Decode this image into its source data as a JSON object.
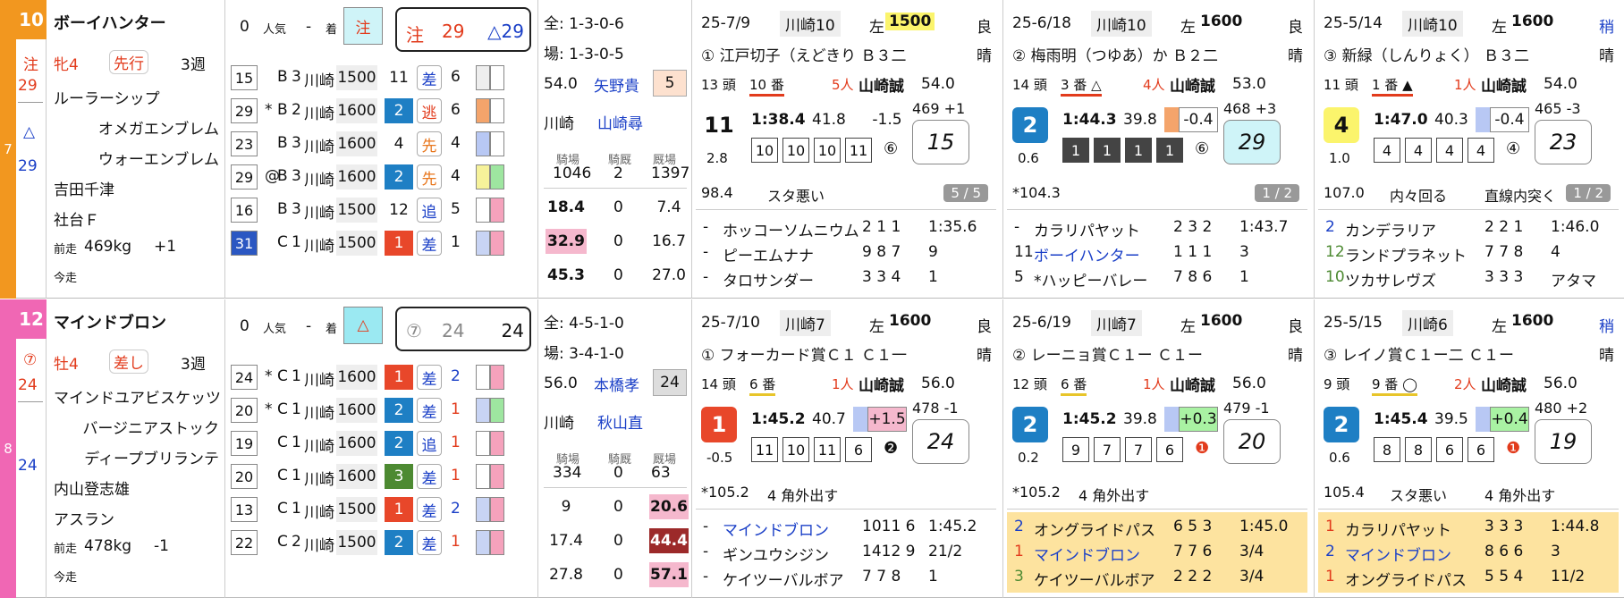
{
  "horses": [
    {
      "gate": "7",
      "num": "10",
      "gate_color": "#f2971f",
      "num_color": "#f2971f",
      "mark": "注",
      "mark_val": "29",
      "sub_mark": "△",
      "sub_val": "29",
      "name": "ボーイハンター",
      "sex_age": "牝4",
      "style": "先行",
      "weeks": "3週",
      "sire": "ルーラーシップ",
      "dam": "オメガエンブレム",
      "damsire": "ウォーエンブレム",
      "trainer": "吉田千津",
      "owner": "社台Ｆ",
      "prev_label": "前走",
      "prev_weight": "469kg",
      "prev_diff": "+1",
      "today_label": "今走",
      "pop": "0",
      "pop_label": "人気",
      "dash": "-",
      "chaku": "着",
      "pred_mark": "注",
      "pred_mark_bg": "#cff4f8",
      "pred_box": [
        "注",
        "29",
        "△29"
      ],
      "past": [
        {
          "a": "15",
          "b": "",
          "cls": "B",
          "g": "3",
          "track": "川崎",
          "dist": "1500",
          "p": "11",
          "pc": "",
          "run": "差",
          "r": "6",
          "c1": "#eee",
          "c2": "#fff"
        },
        {
          "a": "29",
          "b": "*",
          "cls": "B",
          "g": "2",
          "track": "川崎",
          "dist": "1600",
          "p": "2",
          "pc": "#1e7fc4",
          "run": "逃",
          "r": "6",
          "c1": "#f4a46b",
          "c2": "#fff"
        },
        {
          "a": "23",
          "b": "",
          "cls": "B",
          "g": "3",
          "track": "川崎",
          "dist": "1600",
          "p": "4",
          "pc": "",
          "run": "先",
          "r": "4",
          "c1": "#b8c8f4",
          "c2": "#fff"
        },
        {
          "a": "29",
          "b": "@",
          "cls": "B",
          "g": "3",
          "track": "川崎",
          "dist": "1600",
          "p": "2",
          "pc": "#1e7fc4",
          "run": "先",
          "r": "4",
          "c1": "#f6f29a",
          "c2": "#9ee6a0"
        },
        {
          "a": "16",
          "b": "",
          "cls": "B",
          "g": "3",
          "track": "川崎",
          "dist": "1500",
          "p": "12",
          "pc": "",
          "run": "追",
          "r": "5",
          "c1": "#fff",
          "c2": "#f5a2bc"
        },
        {
          "a": "31",
          "b": "",
          "cls": "C",
          "g": "1",
          "track": "川崎",
          "dist": "1500",
          "p": "1",
          "pc": "#e8472a",
          "run": "差",
          "r": "1",
          "c1": "#c8d4f4",
          "c2": "#f5a2bc"
        }
      ],
      "stats": {
        "all": "全: 1-3-0-6",
        "place": "場: 1-3-0-5",
        "weight": "54.0",
        "jockey": "矢野貴",
        "jnum": "5",
        "track": "川崎",
        "trainer2": "山崎尋",
        "h1": "騎場",
        "h2": "騎厩",
        "h3": "厩場",
        "v1": "1046",
        "v2": "2",
        "v3": "1397",
        "rows": [
          [
            "18.4",
            "0",
            "7.4"
          ],
          [
            "32.9",
            "0",
            "16.7"
          ],
          [
            "45.3",
            "0",
            "27.0"
          ]
        ]
      },
      "races": [
        {
          "date": "25-7/9",
          "track": "川崎10",
          "dist": "左",
          "distv": "1500",
          "cond": "良",
          "name": "① 江戸切子（えどきり Ｂ３二",
          "weather": "晴",
          "heads": "13 頭",
          "gate": "10 番",
          "pop": "5人",
          "jockey": "山崎誠",
          "wt": "54.0",
          "finish": "11",
          "time": "1:38.4",
          "last3": "41.8",
          "diff": "-1.5",
          "bw": "469 +1",
          "odds": "2.8",
          "pos": [
            "10",
            "10",
            "10",
            "11"
          ],
          "pk": "⑥",
          "oddsval": "15",
          "idx": "98.4",
          "comment": "スタ悪い",
          "comment2": "",
          "tag": "5 / 5",
          "res": [
            [
              "-",
              "ホッコーソムニウム",
              "2 1 1",
              "1:35.6"
            ],
            [
              "-",
              "ピーエムナナ",
              "9 8 7",
              "9"
            ],
            [
              "-",
              "タロサンダー",
              "3 3 4",
              "1"
            ]
          ]
        },
        {
          "date": "25-6/18",
          "track": "川崎10",
          "dist": "左",
          "distv": "1600",
          "cond": "良",
          "name": "② 梅雨明（つゆあ）か Ｂ２二",
          "weather": "晴",
          "heads": "14 頭",
          "gate": "3 番 △",
          "pop": "4人",
          "jockey": "山崎誠",
          "wt": "53.0",
          "finish": "2",
          "time": "1:44.3",
          "last3": "39.8",
          "diff": "-0.4",
          "bw": "468 +3",
          "odds": "0.6",
          "pos": [
            "1",
            "1",
            "1",
            "1"
          ],
          "pk": "⑥",
          "oddsval": "29",
          "idx": "*104.3",
          "comment": "",
          "comment2": "",
          "tag": "1 / 2",
          "res": [
            [
              "-",
              "カラリパヤット",
              "2 3 2",
              "1:43.7"
            ],
            [
              "11",
              "ボーイハンター",
              "1 1 1",
              "3"
            ],
            [
              "5",
              "*ハッピーバレー",
              "7 8 6",
              "1"
            ]
          ]
        },
        {
          "date": "25-5/14",
          "track": "川崎10",
          "dist": "左",
          "distv": "1600",
          "cond": "稍",
          "name": "③ 新緑（しんりょく） Ｂ３二",
          "weather": "晴",
          "heads": "11 頭",
          "gate": "1 番 ▲",
          "pop": "1人",
          "jockey": "山崎誠",
          "wt": "54.0",
          "finish": "4",
          "time": "1:47.0",
          "last3": "40.3",
          "diff": "-0.4",
          "bw": "465 -3",
          "odds": "1.0",
          "pos": [
            "4",
            "4",
            "4",
            "4"
          ],
          "pk": "④",
          "oddsval": "23",
          "idx": "107.0",
          "comment": "内々回る",
          "comment2": "直線内突く",
          "tag": "1 / 2",
          "res": [
            [
              "2",
              "カンデラリア",
              "2 2 1",
              "1:46.0"
            ],
            [
              "12",
              "ランドプラネット",
              "7 7 8",
              "4"
            ],
            [
              "10",
              "ツカサレヴズ",
              "3 3 3",
              "アタマ"
            ]
          ]
        }
      ]
    },
    {
      "gate": "8",
      "num": "12",
      "gate_color": "#f067b4",
      "num_color": "#f067b4",
      "mark": "⑦",
      "mark_val": "24",
      "sub_mark": "",
      "sub_val": "24",
      "name": "マインドブロン",
      "sex_age": "牡4",
      "style": "差し",
      "weeks": "3週",
      "sire": "マインドユアビスケッツ",
      "dam": "バージニアストック",
      "damsire": "ディープブリランテ",
      "trainer": "内山登志雄",
      "owner": "アスラン",
      "prev_label": "前走",
      "prev_weight": "478kg",
      "prev_diff": "-1",
      "today_label": "今走",
      "pop": "0",
      "pop_label": "人気",
      "dash": "-",
      "chaku": "着",
      "pred_mark": "△",
      "pred_mark_bg": "#9be9f2",
      "pred_box": [
        "⑦",
        "24",
        "24"
      ],
      "past": [
        {
          "a": "24",
          "b": "*",
          "cls": "C",
          "g": "1",
          "track": "川崎",
          "dist": "1600",
          "p": "1",
          "pc": "#e8472a",
          "run": "差",
          "r": "2",
          "c1": "#fff",
          "c2": "#f5a2bc"
        },
        {
          "a": "20",
          "b": "*",
          "cls": "C",
          "g": "1",
          "track": "川崎",
          "dist": "1600",
          "p": "2",
          "pc": "#1e7fc4",
          "run": "差",
          "r": "1",
          "c1": "#c8d4f4",
          "c2": "#9ee6a0"
        },
        {
          "a": "19",
          "b": "",
          "cls": "C",
          "g": "1",
          "track": "川崎",
          "dist": "1600",
          "p": "2",
          "pc": "#1e7fc4",
          "run": "追",
          "r": "1",
          "c1": "#fff",
          "c2": "#f5a2bc"
        },
        {
          "a": "20",
          "b": "",
          "cls": "C",
          "g": "1",
          "track": "川崎",
          "dist": "1600",
          "p": "3",
          "pc": "#4d8a32",
          "run": "差",
          "r": "1",
          "c1": "#fff",
          "c2": "#f5a2bc"
        },
        {
          "a": "13",
          "b": "",
          "cls": "C",
          "g": "1",
          "track": "川崎",
          "dist": "1500",
          "p": "1",
          "pc": "#e8472a",
          "run": "差",
          "r": "2",
          "c1": "#c8d4f4",
          "c2": "#f5a2bc"
        },
        {
          "a": "22",
          "b": "",
          "cls": "C",
          "g": "2",
          "track": "川崎",
          "dist": "1500",
          "p": "2",
          "pc": "#1e7fc4",
          "run": "差",
          "r": "1",
          "c1": "#c8d4f4",
          "c2": "#f5a2bc"
        }
      ],
      "stats": {
        "all": "全: 4-5-1-0",
        "place": "場: 3-4-1-0",
        "weight": "56.0",
        "jockey": "本橋孝",
        "jnum": "24",
        "track": "川崎",
        "trainer2": "秋山直",
        "h1": "騎場",
        "h2": "騎厩",
        "h3": "厩場",
        "v1": "334",
        "v2": "0",
        "v3": "63",
        "rows": [
          [
            "9",
            "0",
            "20.6"
          ],
          [
            "17.4",
            "0",
            "44.4"
          ],
          [
            "27.8",
            "0",
            "57.1"
          ]
        ]
      },
      "races": [
        {
          "date": "25-7/10",
          "track": "川崎7",
          "dist": "左",
          "distv": "1600",
          "cond": "良",
          "name": "① フォーカード賞Ｃ１ Ｃ１一",
          "weather": "晴",
          "heads": "14 頭",
          "gate": "6 番",
          "pop": "1人",
          "jockey": "山崎誠",
          "wt": "56.0",
          "finish": "1",
          "time": "1:45.2",
          "last3": "40.7",
          "diff": "+1.5",
          "bw": "478 -1",
          "odds": "-0.5",
          "pos": [
            "11",
            "10",
            "11",
            "6"
          ],
          "pk": "❷",
          "oddsval": "24",
          "idx": "*105.2",
          "comment": "4 角外出す",
          "comment2": "",
          "tag": "",
          "res": [
            [
              "-",
              "マインドブロン",
              "1011 6",
              "1:45.2"
            ],
            [
              "-",
              "ギンユウシジン",
              "1412 9",
              "21/2"
            ],
            [
              "-",
              "ケイツーバルボア",
              "7 7 8",
              "1"
            ]
          ]
        },
        {
          "date": "25-6/19",
          "track": "川崎7",
          "dist": "左",
          "distv": "1600",
          "cond": "良",
          "name": "② レーニョ賞Ｃ１ー Ｃ１ー",
          "weather": "晴",
          "heads": "12 頭",
          "gate": "6 番",
          "pop": "1人",
          "jockey": "山崎誠",
          "wt": "56.0",
          "finish": "2",
          "time": "1:45.2",
          "last3": "39.8",
          "diff": "+0.3",
          "bw": "479 -1",
          "odds": "0.2",
          "pos": [
            "9",
            "7",
            "7",
            "6"
          ],
          "pk": "❶",
          "oddsval": "20",
          "idx": "*105.2",
          "comment": "4 角外出す",
          "comment2": "",
          "tag": "",
          "res": [
            [
              "2",
              "オングライドパス",
              "6 5 3",
              "1:45.0"
            ],
            [
              "1",
              "マインドブロン",
              "7 7 6",
              "3/4"
            ],
            [
              "3",
              "ケイツーバルボア",
              "2 2 2",
              "3/4"
            ]
          ]
        },
        {
          "date": "25-5/15",
          "track": "川崎6",
          "dist": "左",
          "distv": "1600",
          "cond": "稍",
          "name": "③ レイノ賞Ｃ１ー二 Ｃ１ー",
          "weather": "晴",
          "heads": "9 頭",
          "gate": "9 番 ◯",
          "pop": "2人",
          "jockey": "山崎誠",
          "wt": "56.0",
          "finish": "2",
          "time": "1:45.4",
          "last3": "39.5",
          "diff": "+0.4",
          "bw": "480 +2",
          "odds": "0.6",
          "pos": [
            "8",
            "8",
            "6",
            "6"
          ],
          "pk": "❶",
          "oddsval": "19",
          "idx": "105.4",
          "comment": "スタ悪い",
          "comment2": "4 角外出す",
          "tag": "",
          "res": [
            [
              "1",
              "カラリパヤット",
              "3 3 3",
              "1:44.8"
            ],
            [
              "2",
              "マインドブロン",
              "8 6 6",
              "3"
            ],
            [
              "1",
              "オングライドパス",
              "5 5 4",
              "11/2"
            ]
          ]
        }
      ]
    }
  ],
  "race_left": [
    774,
    1122,
    1470
  ],
  "colors": {
    "finish_red": "#e8472a",
    "finish_blue": "#1e7fc4",
    "finish_yellow": "#fbf46c",
    "diff_green": "#a9f2a3",
    "diff_pink": "#f5b8cd",
    "highlight": "#fde39f"
  }
}
